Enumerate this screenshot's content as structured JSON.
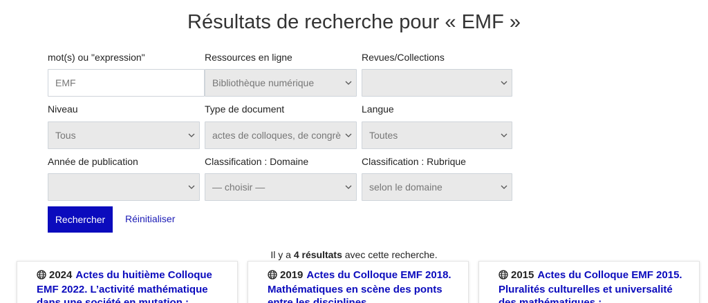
{
  "page": {
    "title": "Résultats de recherche pour « EMF »"
  },
  "search_form": {
    "keyword": {
      "label": "mot(s) ou \"expression\"",
      "value": "EMF"
    },
    "resources": {
      "label": "Ressources en ligne",
      "value": "Bibliothèque numérique"
    },
    "collections": {
      "label": "Revues/Collections",
      "value": ""
    },
    "level": {
      "label": "Niveau",
      "value": "Tous"
    },
    "doc_type": {
      "label": "Type de document",
      "value": "actes de colloques, de congrès"
    },
    "language": {
      "label": "Langue",
      "value": "Toutes"
    },
    "pub_year": {
      "label": "Année de publication",
      "value": ""
    },
    "domain": {
      "label": "Classification : Domaine",
      "value": "— choisir —"
    },
    "rubric": {
      "label": "Classification : Rubrique",
      "value": "selon le domaine"
    },
    "search_button": "Rechercher",
    "reset_link": "Réinitialiser"
  },
  "results": {
    "count_prefix": "Il y a ",
    "count_bold": "4 résultats",
    "count_suffix": " avec cette recherche.",
    "items": [
      {
        "year": "2024",
        "title": "Actes du huitième Colloque EMF 2022. L’activité mathématique dans une société en mutation :",
        "icon": "globe-icon"
      },
      {
        "year": "2019",
        "title": "Actes du Colloque EMF 2018. Mathématiques en scène des ponts entre les disciplines.",
        "icon": "globe-icon"
      },
      {
        "year": "2015",
        "title": "Actes du Colloque EMF 2015. Pluralités culturelles et universalité des mathématiques :",
        "icon": "globe-icon"
      }
    ]
  },
  "colors": {
    "primary_button": "#0b0bbd",
    "link": "#1a1ab5",
    "select_bg": "#e9e9e9"
  }
}
